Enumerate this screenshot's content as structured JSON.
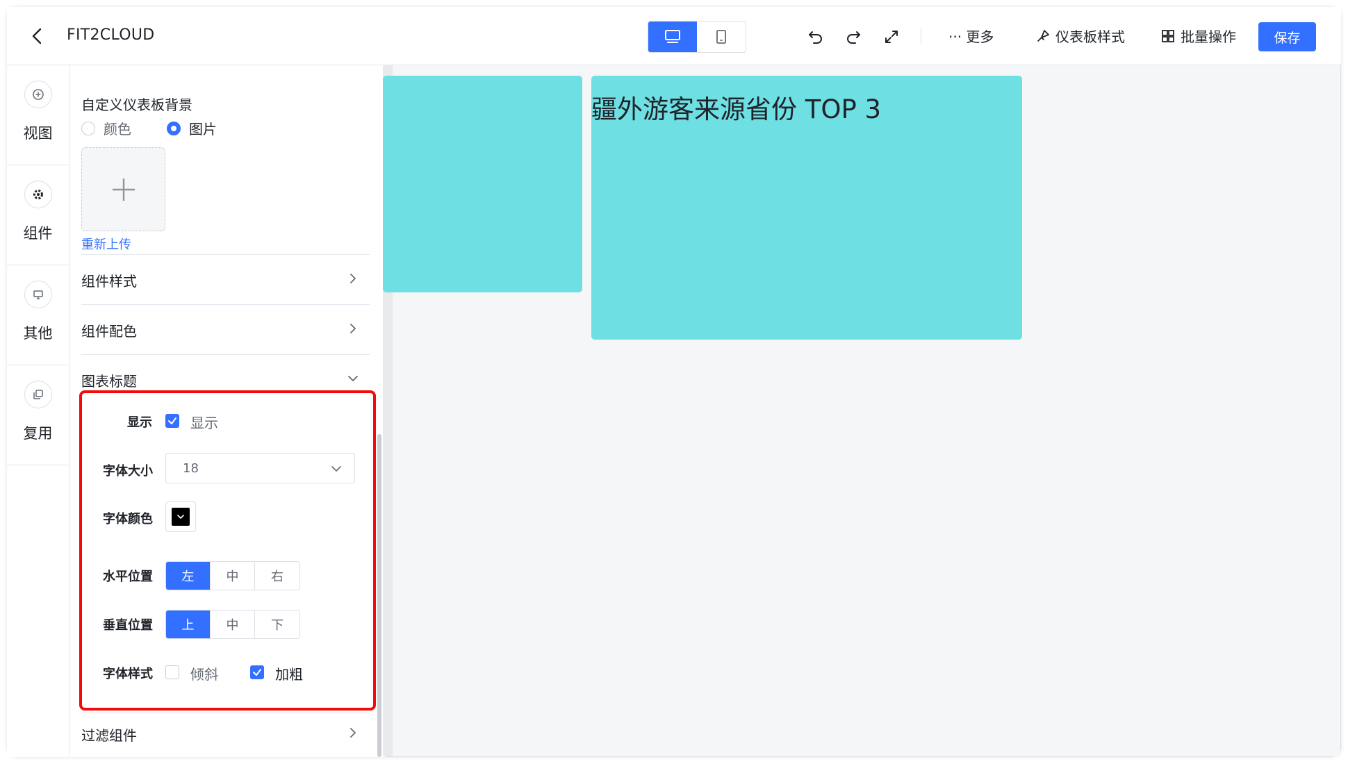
{
  "app": {
    "title": "FIT2CLOUD"
  },
  "toolbar": {
    "more": "··· 更多",
    "dashboard_style": "仪表板样式",
    "batch_ops": "批量操作",
    "save": "保存",
    "accent_color": "#3370ff"
  },
  "rail": {
    "items": [
      {
        "label": "视图",
        "icon": "plus-circle-icon"
      },
      {
        "label": "组件",
        "icon": "gear-icon"
      },
      {
        "label": "其他",
        "icon": "monitor-icon"
      },
      {
        "label": "复用",
        "icon": "copy-icon"
      }
    ]
  },
  "panel": {
    "background": {
      "title": "自定义仪表板背景",
      "option_color": "颜色",
      "option_image": "图片",
      "selected": "图片",
      "reupload": "重新上传"
    },
    "sections": {
      "component_style": "组件样式",
      "component_colors": "组件配色",
      "chart_title": "图表标题",
      "filter_component": "过滤组件"
    },
    "title_settings": {
      "show_label": "显示",
      "show_checkbox_label": "显示",
      "show_checked": true,
      "font_size_label": "字体大小",
      "font_size_value": "18",
      "font_color_label": "字体颜色",
      "font_color_value": "#000000",
      "h_position_label": "水平位置",
      "h_options": [
        "左",
        "中",
        "右"
      ],
      "h_selected": "左",
      "v_position_label": "垂直位置",
      "v_options": [
        "上",
        "中",
        "下"
      ],
      "v_selected": "上",
      "font_style_label": "字体样式",
      "italic_label": "倾斜",
      "italic_checked": false,
      "bold_label": "加粗",
      "bold_checked": true
    }
  },
  "canvas": {
    "card_color": "#6ee0e3",
    "card2_title": "疆外游客来源省份 TOP 3"
  }
}
